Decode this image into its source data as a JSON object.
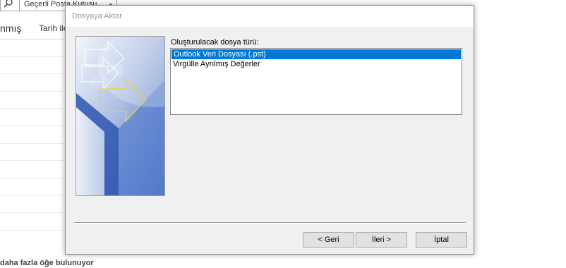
{
  "background": {
    "search_scope": "Geçerli Posta Kutusu",
    "header_left": "nmış",
    "header_date": "Tarih ile",
    "more_items": "daha fazla öğe bulunuyor"
  },
  "dialog": {
    "title": "Dosyaya Aktar",
    "filetype_label": "Oluşturulacak dosya türü:",
    "filetypes": [
      "Outlook Veri Dosyası (.pst)",
      "Virgülle Ayrılmış Değerler"
    ],
    "selected_index": 0,
    "buttons": {
      "back": "< Geri",
      "next": "İleri >",
      "cancel": "İptal"
    }
  },
  "colors": {
    "selection": "#0078d7",
    "dialog_bg": "#f0f0f0",
    "banner_blue": "#2d5bb8",
    "arrow_yellow": "#f2c94c"
  }
}
